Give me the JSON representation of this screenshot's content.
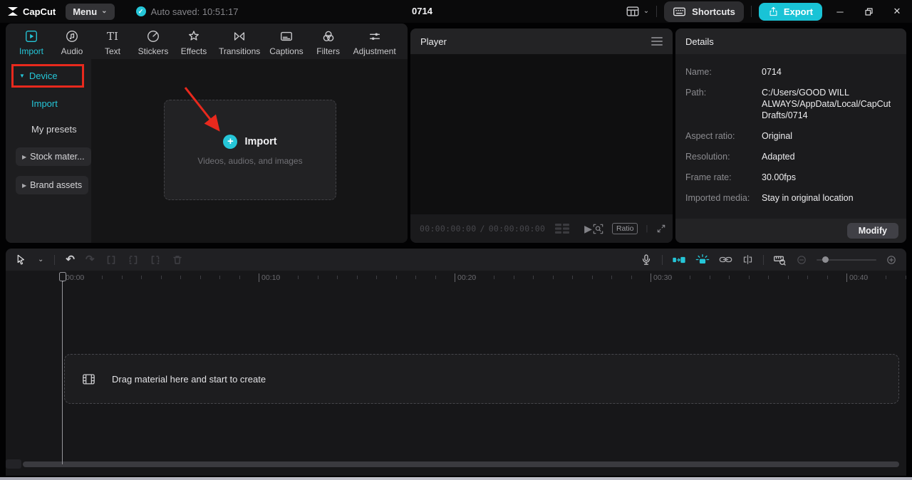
{
  "colors": {
    "accent": "#25c6d8",
    "annotation": "#e8291d",
    "export-bg": "#19c3d6"
  },
  "topbar": {
    "logo_text": "CapCut",
    "menu_label": "Menu",
    "autosave_text": "Auto saved: 10:51:17",
    "project_title": "0714",
    "shortcuts_label": "Shortcuts",
    "export_label": "Export"
  },
  "media": {
    "tabs": [
      {
        "label": "Import"
      },
      {
        "label": "Audio"
      },
      {
        "label": "Text"
      },
      {
        "label": "Stickers"
      },
      {
        "label": "Effects"
      },
      {
        "label": "Transitions"
      },
      {
        "label": "Captions"
      },
      {
        "label": "Filters"
      },
      {
        "label": "Adjustment"
      }
    ],
    "sidebar": {
      "device": "Device",
      "import": "Import",
      "my_presets": "My presets",
      "stock_materials": "Stock mater...",
      "brand_assets": "Brand assets"
    },
    "import_card": {
      "title": "Import",
      "subtitle": "Videos, audios, and images"
    }
  },
  "player": {
    "title": "Player",
    "time_current": "00:00:00:00",
    "time_separator": "/",
    "time_total": "00:00:00:00",
    "ratio_label": "Ratio"
  },
  "details": {
    "title": "Details",
    "rows": [
      {
        "label": "Name:",
        "value": "0714"
      },
      {
        "label": "Path:",
        "value": "C:/Users/GOOD WILL ALWAYS/AppData/Local/CapCut Drafts/0714"
      },
      {
        "label": "Aspect ratio:",
        "value": "Original"
      },
      {
        "label": "Resolution:",
        "value": "Adapted"
      },
      {
        "label": "Frame rate:",
        "value": "30.00fps"
      },
      {
        "label": "Imported media:",
        "value": "Stay in original location"
      }
    ],
    "modify_label": "Modify"
  },
  "timeline": {
    "ruler_labels": [
      "00:00",
      "00:10",
      "00:20",
      "00:30",
      "00:40"
    ],
    "drop_hint": "Drag material here and start to create"
  }
}
